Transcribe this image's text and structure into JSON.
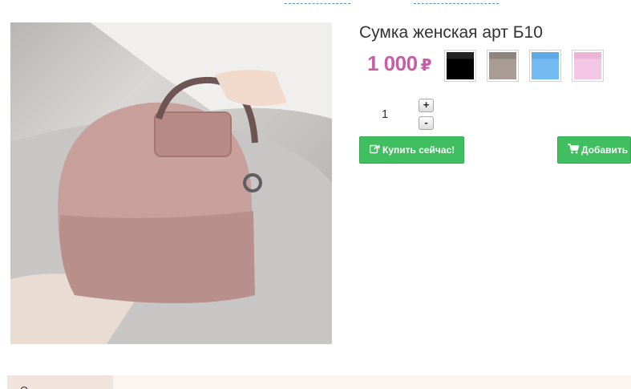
{
  "product": {
    "title": "Сумка женская арт Б10",
    "price": "1 000",
    "currency_symbol": "₽"
  },
  "colors": {
    "price": "#c45fa7",
    "button": "#3fbf5f",
    "swatches": [
      "#000000",
      "#a89c94",
      "#74baf3",
      "#f2c6e4"
    ]
  },
  "swatches": [
    {
      "icon": "color-swatch-black"
    },
    {
      "icon": "color-swatch-taupe"
    },
    {
      "icon": "color-swatch-blue"
    },
    {
      "icon": "color-swatch-pink"
    }
  ],
  "quantity": {
    "value": "1",
    "plus_label": "+",
    "minus_label": "-"
  },
  "buttons": {
    "buy_now": "Купить сейчас!",
    "buy_now_icon": "share-icon",
    "add_to_cart": "Добавить в",
    "add_to_cart_icon": "cart-icon"
  },
  "tabs": {
    "first": "О"
  }
}
